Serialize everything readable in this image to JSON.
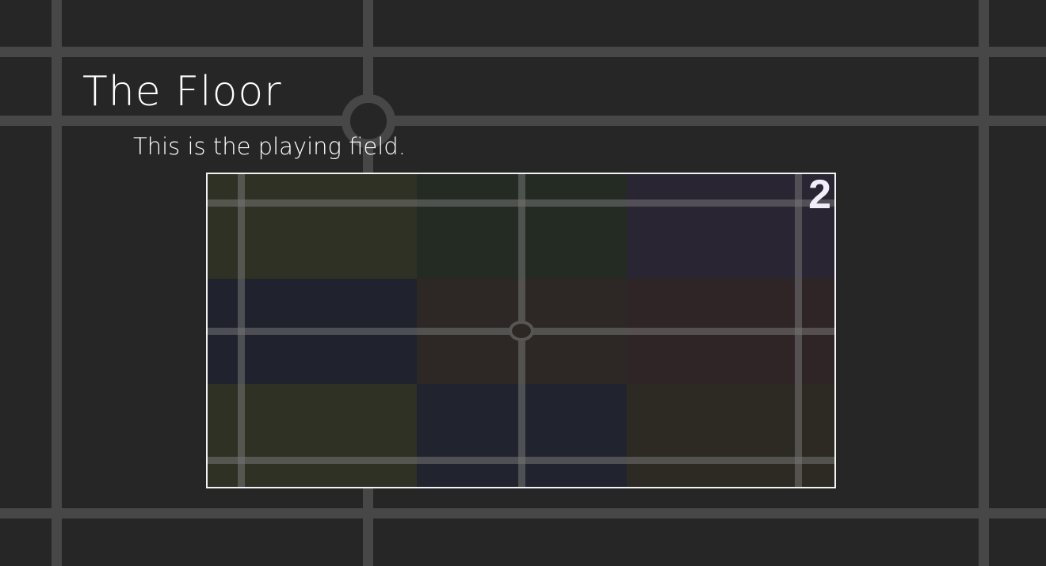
{
  "page": {
    "title": "The Floor",
    "subtitle": "This is the playing field."
  },
  "board": {
    "counter": "2",
    "tiles": [
      {
        "name": "tile-olive-1",
        "color": "#303125"
      },
      {
        "name": "tile-green",
        "color": "#232b23"
      },
      {
        "name": "tile-purple",
        "color": "#292532"
      },
      {
        "name": "tile-navy-1",
        "color": "#20232d"
      },
      {
        "name": "tile-brown-1",
        "color": "#2d2825"
      },
      {
        "name": "tile-maroon",
        "color": "#2f2426"
      },
      {
        "name": "tile-olive-2",
        "color": "#303125"
      },
      {
        "name": "tile-navy-2",
        "color": "#21242e"
      },
      {
        "name": "tile-brown-2",
        "color": "#2d2923"
      }
    ]
  },
  "colors": {
    "background": "#262626",
    "grid_line": "#474747",
    "board_border": "#f2f2f2",
    "text": "#ffffff"
  }
}
